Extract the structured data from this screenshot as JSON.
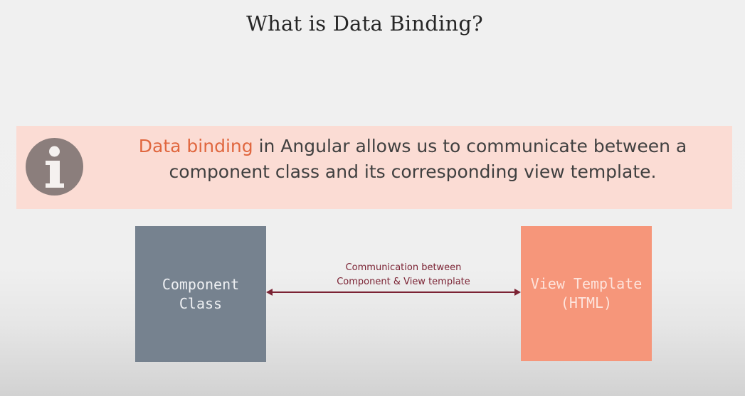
{
  "slide": {
    "title": "What is Data Binding?"
  },
  "info": {
    "icon": "info-icon",
    "highlight": "Data binding",
    "text": " in Angular allows us to communicate between a component class and its corresponding view template.",
    "colors": {
      "banner": "#fbdcd4",
      "highlight": "#e0673f",
      "icon": "#8b7e7c"
    }
  },
  "diagram": {
    "left_box": {
      "label": "Component\nClass",
      "color": "#76828f"
    },
    "right_box": {
      "label": "View Template\n(HTML)",
      "color": "#f6967a"
    },
    "arrow": {
      "label_line1": "Communication between",
      "label_line2": "Component & View template",
      "color": "#7b2334",
      "direction": "bidirectional"
    }
  }
}
